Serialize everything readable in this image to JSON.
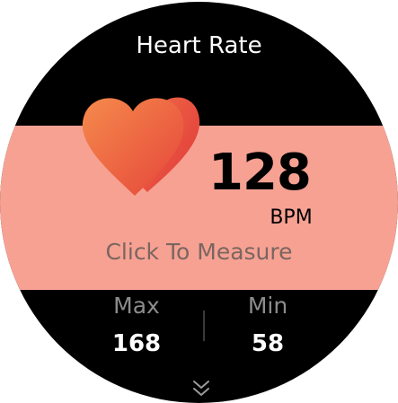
{
  "header": {
    "title": "Heart Rate"
  },
  "measurement": {
    "value": "128",
    "unit": "BPM",
    "action_label": "Click To Measure"
  },
  "stats": {
    "max_label": "Max",
    "max_value": "168",
    "min_label": "Min",
    "min_value": "58"
  },
  "icons": {
    "heart": "heart-icon",
    "more": "chevron-down-double-icon"
  },
  "colors": {
    "background": "#000000",
    "band": "#f7a193",
    "heart_light": "#f5824a",
    "heart_dark": "#e3393a",
    "value_text": "#000000",
    "measure_text": "#7a6660",
    "stat_label": "#8c8c8c",
    "stat_value": "#ffffff"
  }
}
